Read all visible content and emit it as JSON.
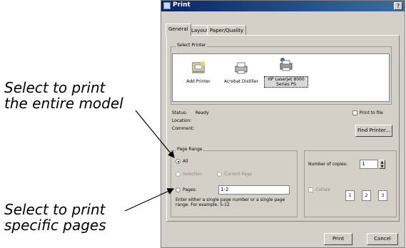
{
  "callouts": {
    "entire_model": "Select to print\nthe entire model",
    "specific_pages": "Select to print\nspecific pages"
  },
  "dialog": {
    "title": "Print",
    "help_glyph": "?",
    "tabs": [
      "General",
      "Layout",
      "Paper/Quality"
    ],
    "select_printer": {
      "label": "Select Printer",
      "printers": [
        {
          "name": "Add Printer",
          "icon": "add-printer-icon"
        },
        {
          "name": "Acrobat Distiller",
          "icon": "printer-icon"
        },
        {
          "name": "HP LaserJet 8000 Series PS",
          "icon": "network-printer-icon",
          "selected": true
        }
      ]
    },
    "status": {
      "label": "Status:",
      "value": "Ready"
    },
    "location": {
      "label": "Location:",
      "value": ""
    },
    "comment": {
      "label": "Comment:",
      "value": ""
    },
    "print_to_file": "Print to file",
    "find_printer": "Find Printer...",
    "page_range": {
      "label": "Page Range",
      "all": "All",
      "selection": "Selection",
      "current_page": "Current Page",
      "pages": "Pages:",
      "pages_value": "1-2",
      "hint": "Enter either a single page number or a single page range. For example, 5-12"
    },
    "copies": {
      "label": "Number of copies:",
      "value": "1",
      "collate": "Collate",
      "collate_pages": [
        "1",
        "2",
        "3"
      ]
    },
    "buttons": {
      "print": "Print",
      "cancel": "Cancel"
    }
  }
}
